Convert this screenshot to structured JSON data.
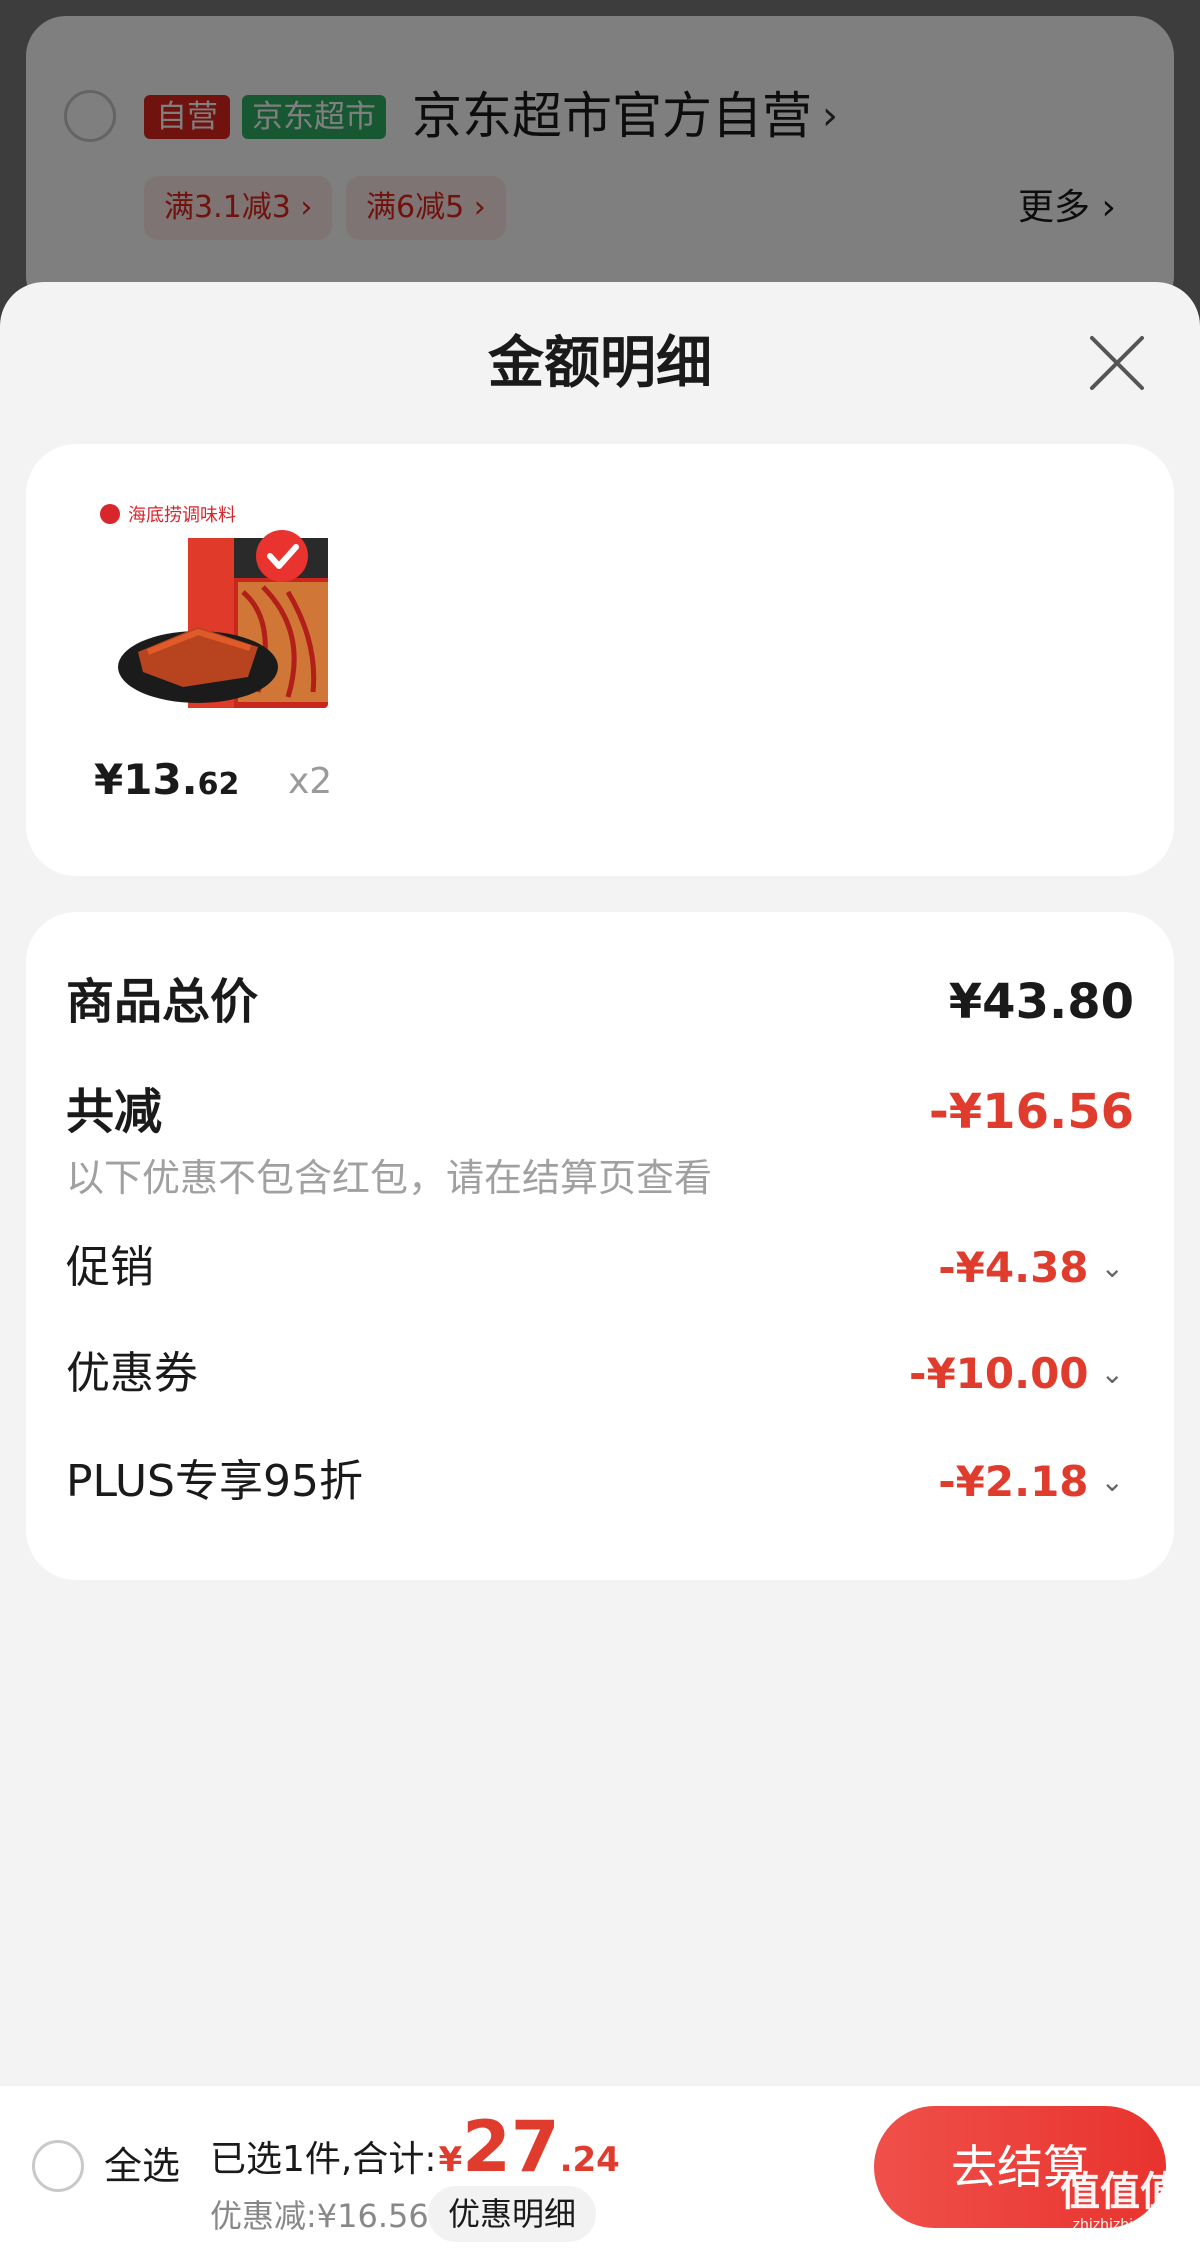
{
  "store": {
    "tag_self": "自营",
    "tag_market": "京东超市",
    "name": "京东超市官方自营",
    "arrow": "›",
    "promos": [
      "满3.1减3 ›",
      "满6减5 ›"
    ],
    "more": "更多 ›"
  },
  "sheet": {
    "title": "金额明细"
  },
  "product": {
    "brand_on_pack": "海底捞调味料",
    "price_main": "¥13.",
    "price_decimal": "62",
    "quantity": "x2"
  },
  "details": {
    "total_label": "商品总价",
    "total_value": "¥43.80",
    "reduce_label": "共减",
    "reduce_value": "-¥16.56",
    "reduce_note": "以下优惠不包含红包，请在结算页查看",
    "items": [
      {
        "label": "促销",
        "value": "-¥4.38"
      },
      {
        "label": "优惠券",
        "value": "-¥10.00"
      },
      {
        "label": "PLUS专享95折",
        "value": "-¥2.18"
      }
    ],
    "chevron": "⌄"
  },
  "bottom": {
    "select_all": "全选",
    "selected_text": "已选1件,合计:",
    "currency": "¥",
    "total_int": "27",
    "total_dec": ".24",
    "discount_text": "优惠减:¥16.56",
    "discount_detail": "优惠明细",
    "checkout": "去结算"
  },
  "watermark": {
    "text": "值值值",
    "sub": "zhizhizhi.com"
  },
  "colors": {
    "accent_red": "#e03c2e",
    "self_tag": "#e1251b",
    "market_tag": "#2eae64"
  }
}
